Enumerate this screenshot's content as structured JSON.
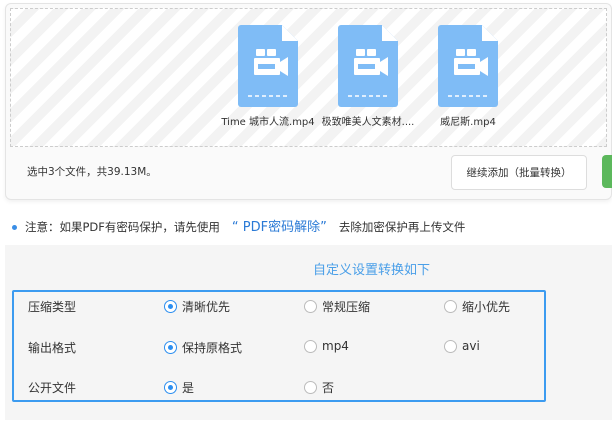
{
  "files": [
    {
      "name": "Time 城市人流.mp4",
      "icon": "video-file-icon"
    },
    {
      "name": "极致唯美人文素材....",
      "icon": "video-file-icon"
    },
    {
      "name": "威尼斯.mp4",
      "icon": "video-file-icon"
    }
  ],
  "status": "选中3个文件，共39.13M。",
  "add_button": "继续添加（批量转换）",
  "notice": {
    "prefix": "注意：如果PDF有密码保护，请先使用",
    "link": "“ PDF密码解除”",
    "suffix": "去除加密保护再上传文件"
  },
  "settings": {
    "title": "自定义设置转换如下",
    "rows": [
      {
        "label": "压缩类型",
        "options": [
          "清晰优先",
          "常规压缩",
          "缩小优先"
        ],
        "selected": 0
      },
      {
        "label": "输出格式",
        "options": [
          "保持原格式",
          "mp4",
          "avi"
        ],
        "selected": 0
      },
      {
        "label": "公开文件",
        "options": [
          "是",
          "否"
        ],
        "selected": 0
      }
    ]
  },
  "colors": {
    "accent": "#3c9bf0",
    "icon": "#7fbcf6"
  }
}
